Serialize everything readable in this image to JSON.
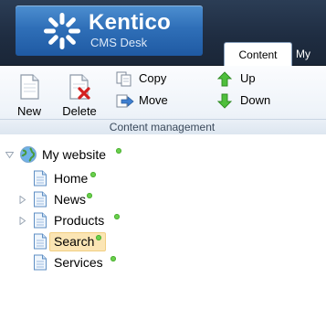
{
  "header": {
    "logo_title": "Kentico",
    "logo_subtitle": "CMS Desk",
    "tabs": [
      {
        "label": "Content",
        "active": true
      },
      {
        "label": "My",
        "active": false
      }
    ],
    "colors": {
      "header_bg": "#1f2d42",
      "logo_bg": "#2f6fb8"
    }
  },
  "ribbon": {
    "buttons": {
      "new": {
        "label": "New",
        "icon": "new-page-icon"
      },
      "delete": {
        "label": "Delete",
        "icon": "delete-page-icon"
      },
      "copy": {
        "label": "Copy",
        "icon": "copy-icon"
      },
      "move": {
        "label": "Move",
        "icon": "move-icon"
      },
      "up": {
        "label": "Up",
        "icon": "arrow-up-icon"
      },
      "down": {
        "label": "Down",
        "icon": "arrow-down-icon"
      }
    },
    "group_label": "Content management"
  },
  "tree": {
    "root": {
      "label": "My website",
      "icon": "globe-icon",
      "expanded": true,
      "published": true
    },
    "children": [
      {
        "label": "Home",
        "has_children": false,
        "selected": false
      },
      {
        "label": "News",
        "has_children": true,
        "selected": false
      },
      {
        "label": "Products",
        "has_children": true,
        "selected": false
      },
      {
        "label": "Search",
        "has_children": false,
        "selected": true
      },
      {
        "label": "Services",
        "has_children": false,
        "selected": false
      }
    ],
    "status_color": "#6ad04c",
    "selected_color": "#fbe5b4"
  }
}
